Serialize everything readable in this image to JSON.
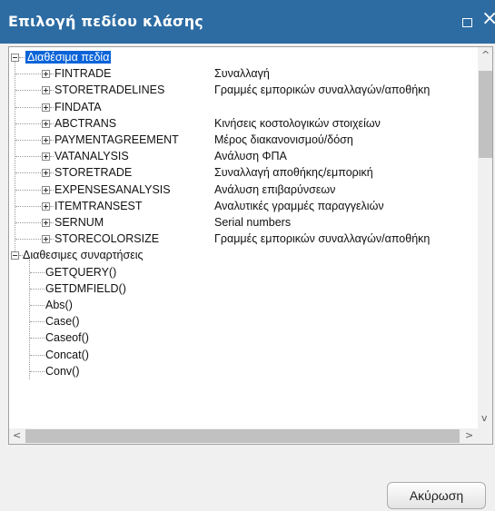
{
  "window": {
    "title": "Επιλογή πεδίου κλάσης"
  },
  "tree": {
    "fields_label": "Διαθέσιμα πεδία",
    "fields": [
      {
        "name": "FINTRADE",
        "desc": "Συναλλαγή"
      },
      {
        "name": "STORETRADELINES",
        "desc": "Γραμμές εμπορικών συναλλαγών/αποθήκη"
      },
      {
        "name": "FINDATA",
        "desc": ""
      },
      {
        "name": "ABCTRANS",
        "desc": "Κινήσεις κοστολογικών στοιχείων"
      },
      {
        "name": "PAYMENTAGREEMENT",
        "desc": "Μέρος διακανονισμού/δόση"
      },
      {
        "name": "VATANALYSIS",
        "desc": "Ανάλυση ΦΠΑ"
      },
      {
        "name": "STORETRADE",
        "desc": "Συναλλαγή αποθήκης/εμπορική"
      },
      {
        "name": "EXPENSESANALYSIS",
        "desc": "Ανάλυση επιβαρύνσεων"
      },
      {
        "name": "ITEMTRANSEST",
        "desc": "Αναλυτικές γραμμές παραγγελιών"
      },
      {
        "name": "SERNUM",
        "desc": "Serial numbers"
      },
      {
        "name": "STORECOLORSIZE",
        "desc": "Γραμμές εμπορικών συναλλαγών/αποθήκη"
      }
    ],
    "functions_label": "Διαθεσιμες συναρτήσεις",
    "functions": [
      "GETQUERY()",
      "GETDMFIELD()",
      "Abs()",
      "Case()",
      "Caseof()",
      "Concat()",
      "Conv()"
    ]
  },
  "buttons": {
    "cancel": "Ακύρωση"
  }
}
